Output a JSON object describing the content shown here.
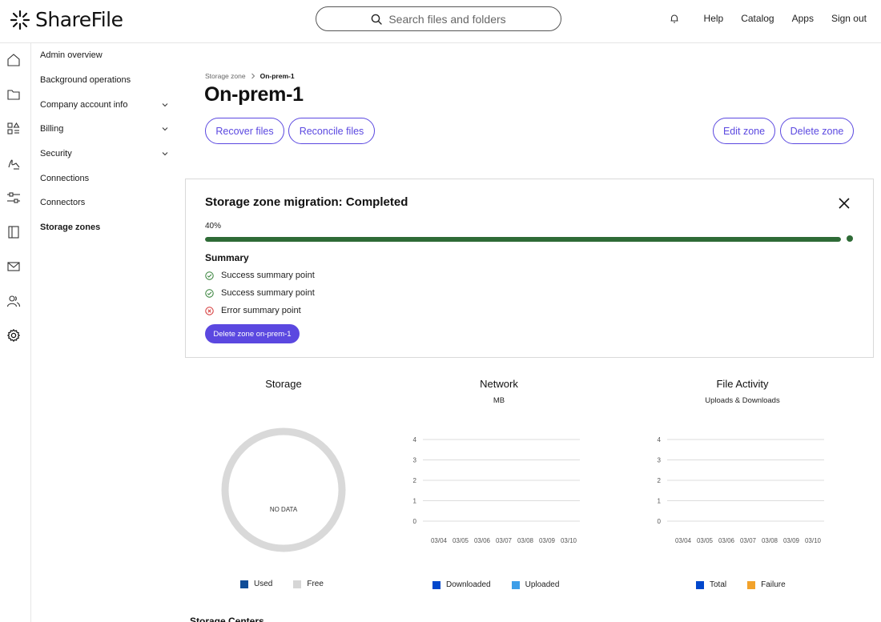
{
  "app": {
    "name": "ShareFile"
  },
  "search": {
    "placeholder": "Search files and folders"
  },
  "top_nav": {
    "help": "Help",
    "catalog": "Catalog",
    "apps": "Apps",
    "sign_out": "Sign out"
  },
  "rail_icons": [
    "home-icon",
    "folder-icon",
    "apps-icon",
    "signature-icon",
    "workflow-icon",
    "document-icon",
    "mail-icon",
    "users-icon",
    "gear-icon"
  ],
  "sidebar": {
    "items": [
      {
        "label": "Admin overview",
        "expandable": false
      },
      {
        "label": "Background operations",
        "expandable": false
      },
      {
        "label": "Company account info",
        "expandable": true
      },
      {
        "label": "Billing",
        "expandable": true
      },
      {
        "label": "Security",
        "expandable": true
      },
      {
        "label": "Connections",
        "expandable": false
      },
      {
        "label": "Connectors",
        "expandable": false
      },
      {
        "label": "Storage zones",
        "expandable": false,
        "active": true
      }
    ]
  },
  "breadcrumb": {
    "parent": "Storage zone",
    "current": "On-prem-1"
  },
  "page": {
    "title": "On-prem-1"
  },
  "actions": {
    "recover": "Recover files",
    "reconcile": "Reconcile files",
    "edit": "Edit zone",
    "delete": "Delete zone"
  },
  "migration": {
    "title": "Storage zone migration:  Completed",
    "progress_label": "40%",
    "progress_value": 1.0,
    "summary_title": "Summary",
    "summary": [
      {
        "text": "Success summary point",
        "status": "success"
      },
      {
        "text": "Success summary point",
        "status": "success"
      },
      {
        "text": "Error summary point",
        "status": "error"
      }
    ],
    "delete_button": "Delete zone on-prem-1"
  },
  "colors": {
    "accent": "#5b48e0",
    "progress": "#2e6b36",
    "success": "#2e7d32",
    "error": "#d32f2f",
    "used": "#0f4c97",
    "free": "#d6d6d6",
    "downloaded": "#0047cc",
    "uploaded": "#3d9ee8",
    "total": "#0047cc",
    "failure": "#f2a22b"
  },
  "chart_data": [
    {
      "type": "pie",
      "title": "Storage",
      "empty_label": "NO DATA",
      "legend": [
        "Used",
        "Free"
      ],
      "values": []
    },
    {
      "type": "line",
      "title": "Network",
      "subtitle": "MB",
      "categories": [
        "03/04",
        "03/05",
        "03/06",
        "03/07",
        "03/08",
        "03/09",
        "03/10"
      ],
      "yticks": [
        "0",
        "1",
        "2",
        "3",
        "4"
      ],
      "ylim": [
        0,
        4
      ],
      "grid": true,
      "series": [
        {
          "name": "Downloaded",
          "values": []
        },
        {
          "name": "Uploaded",
          "values": []
        }
      ]
    },
    {
      "type": "line",
      "title": "File Activity",
      "subtitle": "Uploads & Downloads",
      "categories": [
        "03/04",
        "03/05",
        "03/06",
        "03/07",
        "03/08",
        "03/09",
        "03/10"
      ],
      "yticks": [
        "0",
        "1",
        "2",
        "3",
        "4"
      ],
      "ylim": [
        0,
        4
      ],
      "grid": true,
      "series": [
        {
          "name": "Total",
          "values": []
        },
        {
          "name": "Failure",
          "values": []
        }
      ]
    }
  ],
  "next_section": {
    "title": "Storage Centers"
  }
}
